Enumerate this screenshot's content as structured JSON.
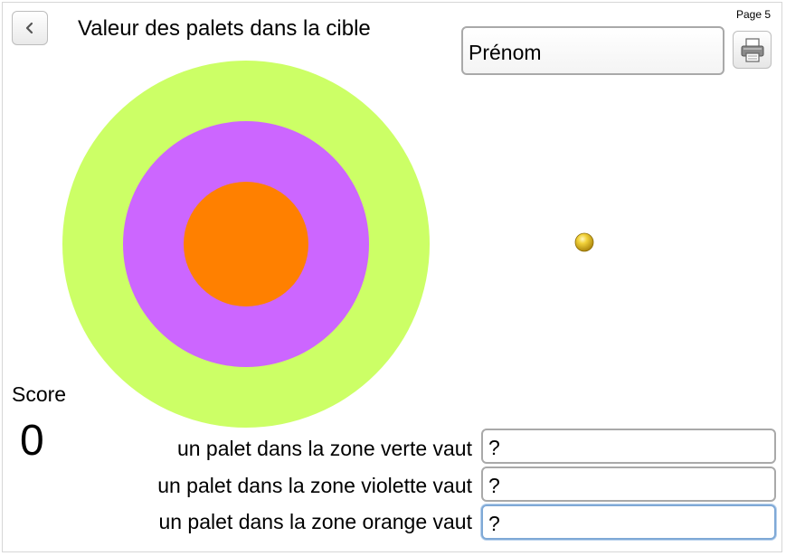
{
  "header": {
    "title": "Valeur des palets dans la cible",
    "page_label": "Page 5",
    "back_icon": "chevron-left-icon",
    "print_icon": "printer-icon"
  },
  "name_field": {
    "value": "Prénom"
  },
  "target": {
    "rings": [
      {
        "zone": "verte",
        "color": "#ccff66"
      },
      {
        "zone": "violette",
        "color": "#cc66ff"
      },
      {
        "zone": "orange",
        "color": "#ff8000"
      }
    ]
  },
  "puck": {
    "color": "#e8c21e",
    "icon": "ball-icon"
  },
  "score": {
    "label": "Score",
    "value": "0"
  },
  "questions": [
    {
      "label": "un palet dans la zone verte vaut",
      "answer": "?"
    },
    {
      "label": "un palet dans la zone violette vaut",
      "answer": "?"
    },
    {
      "label": "un palet dans la zone orange vaut",
      "answer": "?"
    }
  ]
}
